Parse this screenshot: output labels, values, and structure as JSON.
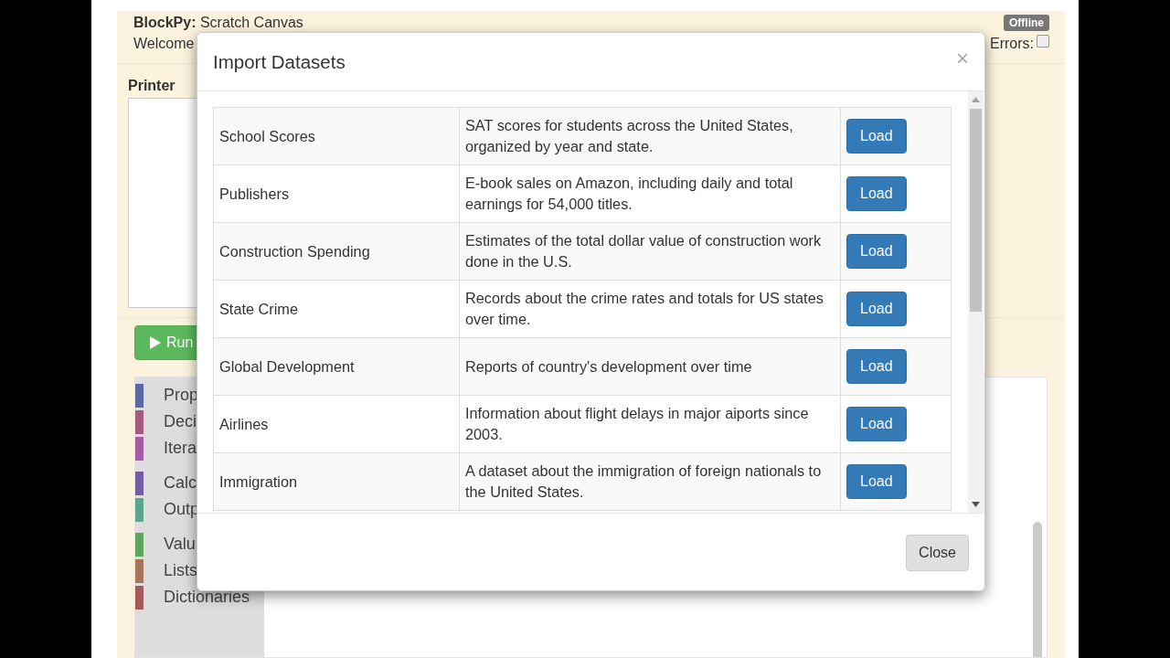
{
  "header": {
    "app_name": "BlockPy:",
    "title": "Scratch Canvas",
    "welcome": "Welcome",
    "status_badge": "Offline",
    "errors_label": "Errors:",
    "errors_checked": false
  },
  "printer": {
    "label": "Printer"
  },
  "run_button": {
    "label": "Run"
  },
  "toolbox": {
    "groups": [
      {
        "categories": [
          {
            "label": "Prop",
            "color": "#5b67a5"
          },
          {
            "label": "Deci",
            "color": "#a55b80"
          },
          {
            "label": "Itera",
            "color": "#a55ba5"
          }
        ]
      },
      {
        "categories": [
          {
            "label": "Calc",
            "color": "#745ba5"
          },
          {
            "label": "Outp",
            "color": "#5ba58c"
          }
        ]
      },
      {
        "categories": [
          {
            "label": "Valu",
            "color": "#5ba55b"
          },
          {
            "label": "Lists",
            "color": "#a5745b"
          },
          {
            "label": "Dictionaries",
            "color": "#a55b5b"
          }
        ]
      }
    ]
  },
  "dialog": {
    "title": "Import Datasets",
    "close_icon": "×",
    "close_button": "Close",
    "datasets": [
      {
        "name": "School Scores",
        "description": "SAT scores for students across the United States, organized by year and state.",
        "action": "Load"
      },
      {
        "name": "Publishers",
        "description": "E-book sales on Amazon, including daily and total earnings for 54,000 titles.",
        "action": "Load"
      },
      {
        "name": "Construction Spending",
        "description": "Estimates of the total dollar value of construction work done in the U.S.",
        "action": "Load"
      },
      {
        "name": "State Crime",
        "description": "Records about the crime rates and totals for US states over time.",
        "action": "Load"
      },
      {
        "name": "Global Development",
        "description": "Reports of country's development over time",
        "action": "Load"
      },
      {
        "name": "Airlines",
        "description": "Information about flight delays in major aiports since 2003.",
        "action": "Load"
      },
      {
        "name": "Immigration",
        "description": "A dataset about the immigration of foreign nationals to the United States.",
        "action": "Load"
      }
    ]
  }
}
